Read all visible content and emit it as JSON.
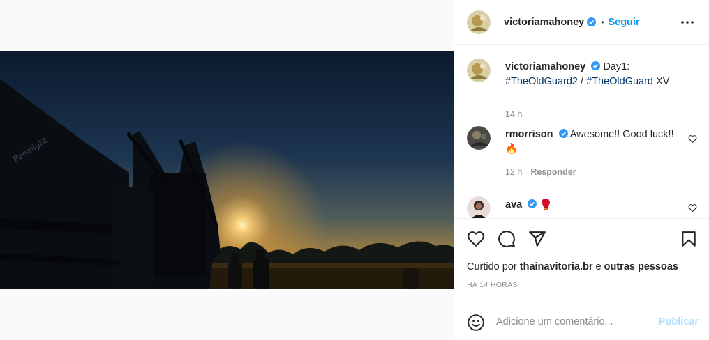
{
  "post": {
    "author": "victoriamahoney",
    "follow_label": "Seguir",
    "separator": "•",
    "more_icon": "more-horizontal-icon",
    "photo_alt": "Silhueta de máquinas e pessoas ao pôr do sol"
  },
  "caption": {
    "user": "victoriamahoney",
    "text": "Day1:",
    "hashtag1": "#TheOldGuard2",
    "slash": " / ",
    "hashtag2": "#TheOldGuard",
    "tail": " XV",
    "time": "14 h"
  },
  "comments": [
    {
      "user": "rmorrison",
      "text": "Awesome!! Good luck!!",
      "emoji": "🔥",
      "time": "12 h",
      "reply_label": "Responder"
    },
    {
      "user": "ava",
      "emoji": "🥊"
    }
  ],
  "actions": {
    "like_icon": "heart-icon",
    "comment_icon": "comment-icon",
    "share_icon": "share-icon",
    "save_icon": "bookmark-icon"
  },
  "likes": {
    "prefix": "Curtido por ",
    "user": "thainavitoria.br",
    "conj": " e ",
    "others": "outras pessoas"
  },
  "time_ago": "Há 14 horas",
  "comment_box": {
    "placeholder": "Adicione um comentário...",
    "publish_label": "Publicar"
  },
  "colors": {
    "accent": "#0095f6",
    "verified": "#3897f0",
    "publish_disabled": "#b2dffc",
    "muted": "#8e8e8e",
    "hashtag": "#00376b"
  }
}
